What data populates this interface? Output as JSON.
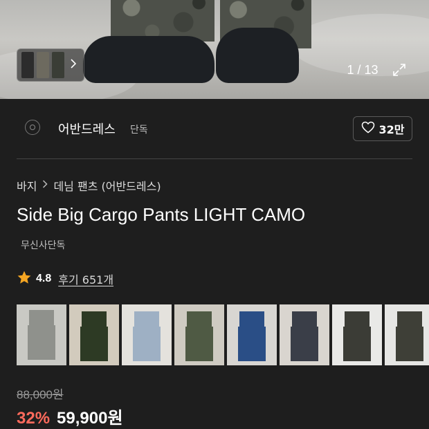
{
  "hero": {
    "counter": "1 / 13",
    "thumb_next_icon": "chevron-right-icon",
    "expand_icon": "expand-icon"
  },
  "brand": {
    "name": "어반드레스",
    "tag": "단독",
    "like_icon": "heart-icon",
    "like_count": "32만"
  },
  "breadcrumb": {
    "category": "바지",
    "separator_icon": "chevron-right-icon",
    "subcategory": "데님 팬츠 (어반드레스)"
  },
  "product": {
    "title": "Side Big Cargo Pants LIGHT CAMO",
    "exclusive_label": "무신사단독",
    "rating": "4.8",
    "rating_icon": "star-icon",
    "review_link": "후기 651개",
    "star_color": "#f5a623"
  },
  "swatches": [
    {
      "name": "light-camo",
      "color": "#8f918c"
    },
    {
      "name": "olive",
      "color": "#2d3a24"
    },
    {
      "name": "light-denim",
      "color": "#9eb0c4"
    },
    {
      "name": "green-camo",
      "color": "#4f5a44"
    },
    {
      "name": "blue-denim",
      "color": "#2a4e86"
    },
    {
      "name": "dark-wash",
      "color": "#3a3e48"
    },
    {
      "name": "black-camo",
      "color": "#3b3c36"
    },
    {
      "name": "woodland-camo",
      "color": "#3e3f37"
    }
  ],
  "price": {
    "original": "88,000원",
    "discount": "32%",
    "sale": "59,900원",
    "discount_color": "#ff6a5c"
  }
}
